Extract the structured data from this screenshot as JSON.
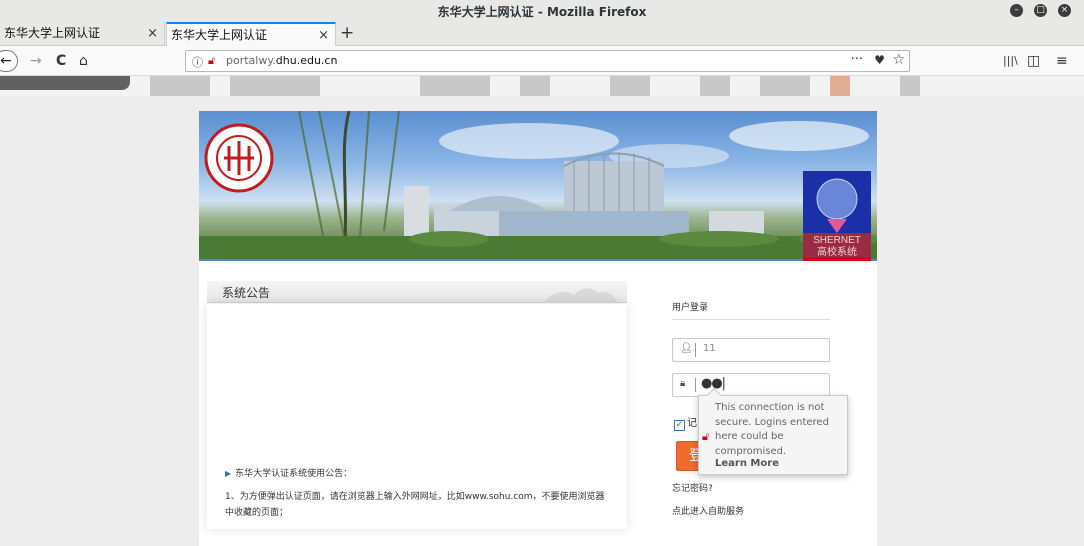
{
  "window": {
    "title": "东华大学上网认证 - Mozilla Firefox",
    "controls": [
      "minimize-icon",
      "maximize-icon",
      "close-icon"
    ]
  },
  "tabs": [
    {
      "label": "东华大学上网认证",
      "close": "×",
      "active": false
    },
    {
      "label": "东华大学上网认证",
      "close": "×",
      "active": true
    }
  ],
  "new_tab_label": "+",
  "navbar": {
    "back": "←",
    "forward": "→",
    "reload": "C",
    "home": "⌂",
    "url_prefix": "portalwy.",
    "url_domain": "dhu.edu.cn",
    "page_actions": "···",
    "pocket": "♥",
    "star": "☆",
    "library": "|||\\",
    "sidebar": "◫",
    "menu": "≡"
  },
  "notice": {
    "heading": "系统公告",
    "item": "东华大学认证系统使用公告：",
    "text": "1、为方便弹出认证页面，请在浏览器上输入外网网址，比如www.sohu.com，不要使用浏览器中收藏的页面；"
  },
  "login": {
    "title": "用户登录",
    "username_value": "11",
    "password_mask": "●●|",
    "remember_label": "记",
    "button_label": "登",
    "forgot": "忘记密码?",
    "self_service": "点此进入自助服务"
  },
  "banner": {
    "sign_text_1": "SHERNET",
    "sign_text_2": "高校系统"
  },
  "security_popup": {
    "message": "This connection is not secure. Logins entered here could be compromised.",
    "learn_more": "Learn More"
  },
  "colors": {
    "accent_tab": "#0a84ff",
    "login_button": "#ef6b2d",
    "insecure_icon": "#d0021b"
  }
}
